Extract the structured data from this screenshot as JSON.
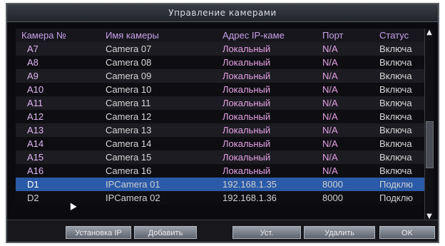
{
  "window": {
    "title": "Управление камерами"
  },
  "table": {
    "headers": [
      "Камера №",
      "Имя камеры",
      "Адрес IP-каме",
      "Порт",
      "Статус"
    ],
    "rows": [
      {
        "id": "A7",
        "name": "Camera 07",
        "address": "Локальный",
        "port": "N/A",
        "status": "Включа"
      },
      {
        "id": "A8",
        "name": "Camera 08",
        "address": "Локальный",
        "port": "N/A",
        "status": "Включа"
      },
      {
        "id": "A9",
        "name": "Camera 09",
        "address": "Локальный",
        "port": "N/A",
        "status": "Включа"
      },
      {
        "id": "A10",
        "name": "Camera 10",
        "address": "Локальный",
        "port": "N/A",
        "status": "Включа"
      },
      {
        "id": "A11",
        "name": "Camera 11",
        "address": "Локальный",
        "port": "N/A",
        "status": "Включа"
      },
      {
        "id": "A12",
        "name": "Camera 12",
        "address": "Локальный",
        "port": "N/A",
        "status": "Включа"
      },
      {
        "id": "A13",
        "name": "Camera 13",
        "address": "Локальный",
        "port": "N/A",
        "status": "Включа"
      },
      {
        "id": "A14",
        "name": "Camera 14",
        "address": "Локальный",
        "port": "N/A",
        "status": "Включа"
      },
      {
        "id": "A15",
        "name": "Camera 15",
        "address": "Локальный",
        "port": "N/A",
        "status": "Включа"
      },
      {
        "id": "A16",
        "name": "Camera 16",
        "address": "Локальный",
        "port": "N/A",
        "status": "Включа"
      },
      {
        "id": "D1",
        "name": "IPCamera 01",
        "address": "192.168.1.35",
        "port": "8000",
        "status": "Подклю"
      },
      {
        "id": "D2",
        "name": "IPCamera 02",
        "address": "192.168.1.36",
        "port": "8000",
        "status": "Подклю"
      }
    ],
    "selected_index": 10
  },
  "buttons": {
    "labels": [
      "Установка IP",
      "Добавить",
      "Уст.",
      "Удалить",
      "OK"
    ]
  },
  "icons": {
    "scroll_up": "chevron-up-icon",
    "scroll_down": "chevron-down-icon",
    "pointer": "mouse-pointer-icon"
  },
  "colors": {
    "header_text": "#c9a0e8",
    "local_address": "#e6a0e6",
    "selected_row": "#2a5aa8"
  }
}
